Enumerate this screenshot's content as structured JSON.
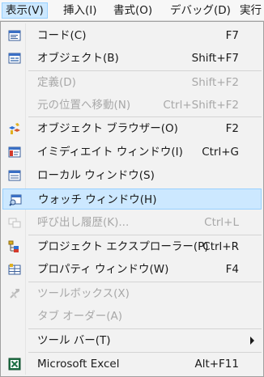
{
  "menubar": {
    "items": [
      {
        "label": "表示(V)"
      },
      {
        "label": "挿入(I)"
      },
      {
        "label": "書式(O)"
      },
      {
        "label": "デバッグ(D)"
      },
      {
        "label": "実行"
      }
    ]
  },
  "menu": {
    "items": [
      {
        "label": "コード(C)",
        "shortcut": "F7",
        "icon": "code-icon",
        "enabled": true
      },
      {
        "label": "オブジェクト(B)",
        "shortcut": "Shift+F7",
        "icon": "object-icon",
        "enabled": true
      },
      {
        "label": "定義(D)",
        "shortcut": "Shift+F2",
        "icon": "",
        "enabled": false
      },
      {
        "label": "元の位置へ移動(N)",
        "shortcut": "Ctrl+Shift+F2",
        "icon": "",
        "enabled": false
      },
      {
        "label": "オブジェクト ブラウザー(O)",
        "shortcut": "F2",
        "icon": "object-browser-icon",
        "enabled": true
      },
      {
        "label": "イミディエイト ウィンドウ(I)",
        "shortcut": "Ctrl+G",
        "icon": "immediate-window-icon",
        "enabled": true
      },
      {
        "label": "ローカル ウィンドウ(S)",
        "shortcut": "",
        "icon": "locals-window-icon",
        "enabled": true
      },
      {
        "label": "ウォッチ ウィンドウ(H)",
        "shortcut": "",
        "icon": "watch-window-icon",
        "enabled": true,
        "highlighted": true
      },
      {
        "label": "呼び出し履歴(K)...",
        "shortcut": "Ctrl+L",
        "icon": "call-stack-icon",
        "enabled": false
      },
      {
        "label": "プロジェクト エクスプローラー(P)",
        "shortcut": "Ctrl+R",
        "icon": "project-explorer-icon",
        "enabled": true
      },
      {
        "label": "プロパティ ウィンドウ(W)",
        "shortcut": "F4",
        "icon": "properties-window-icon",
        "enabled": true
      },
      {
        "label": "ツールボックス(X)",
        "shortcut": "",
        "icon": "toolbox-icon",
        "enabled": false
      },
      {
        "label": "タブ オーダー(A)",
        "shortcut": "",
        "icon": "",
        "enabled": false
      },
      {
        "label": "ツール バー(T)",
        "shortcut": "",
        "icon": "",
        "enabled": true,
        "submenu": true
      },
      {
        "label": "Microsoft Excel",
        "shortcut": "Alt+F11",
        "icon": "excel-icon",
        "enabled": true
      }
    ]
  }
}
